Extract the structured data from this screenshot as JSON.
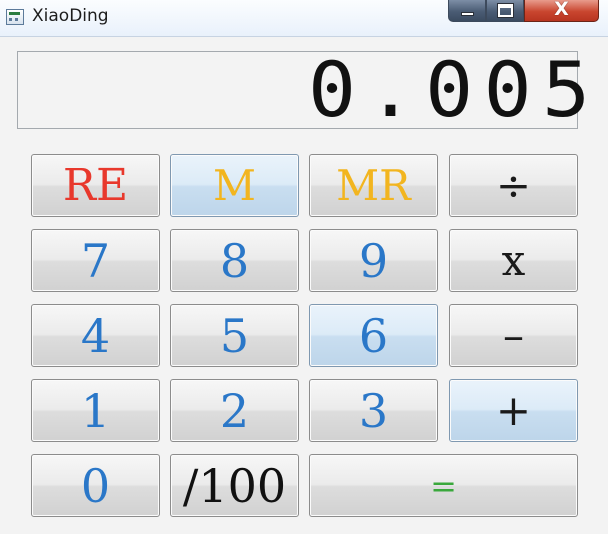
{
  "window": {
    "title": "XiaoDing",
    "minimize_icon": "minimize-icon",
    "maximize_icon": "maximize-icon",
    "close_symbol": "X",
    "app_icon": "calculator-app-icon"
  },
  "display": {
    "value": "0.005"
  },
  "colors": {
    "digit": "#2a77c8",
    "reset": "#e8382c",
    "memory": "#f2b51f",
    "operator": "#1a1a1a",
    "equals": "#3aa83c",
    "highlight_key": "#c9def0"
  },
  "keys": {
    "re": "RE",
    "m": "M",
    "mr": "MR",
    "divide": "÷",
    "seven": "7",
    "eight": "8",
    "nine": "9",
    "multiply": "x",
    "four": "4",
    "five": "5",
    "six": "6",
    "minus": "–",
    "one": "1",
    "two": "2",
    "three": "3",
    "plus": "+",
    "zero": "0",
    "percent": "/100",
    "equals": "="
  }
}
